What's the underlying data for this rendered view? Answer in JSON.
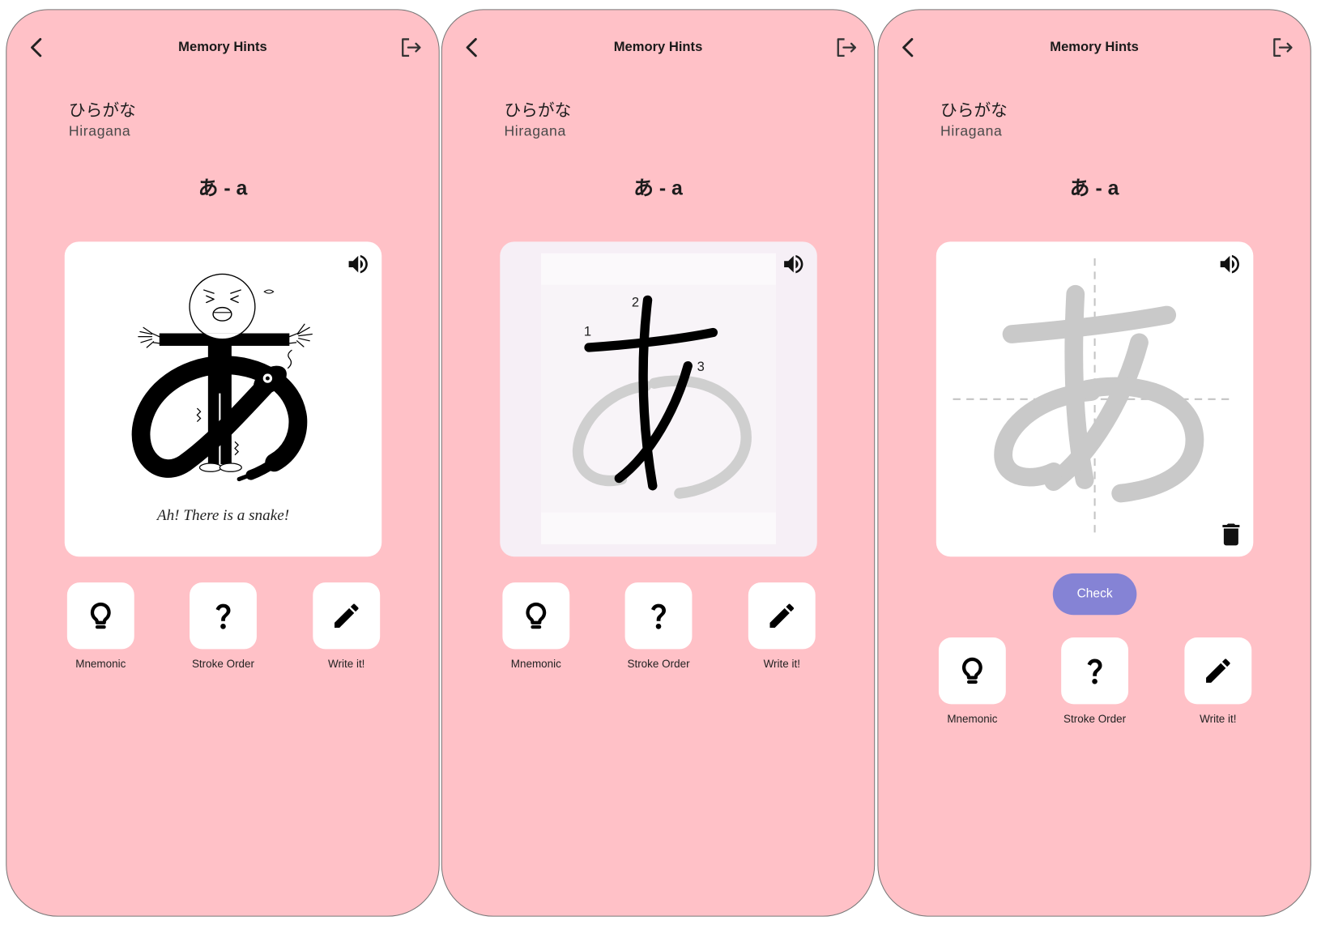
{
  "screens": [
    {
      "header": {
        "title": "Memory Hints",
        "back_icon": "chevron-left-icon",
        "exit_icon": "logout-icon"
      },
      "script": {
        "native": "ひらがな",
        "romaji": "Hiragana"
      },
      "character": "あ - a",
      "card": {
        "speaker_icon": "speaker-icon",
        "caption": "Ah! There is a snake!"
      },
      "actions": [
        {
          "label": "Mnemonic",
          "icon": "lightbulb-icon"
        },
        {
          "label": "Stroke Order",
          "icon": "question-mark-icon"
        },
        {
          "label": "Write it!",
          "icon": "pencil-icon"
        }
      ]
    },
    {
      "header": {
        "title": "Memory Hints",
        "back_icon": "chevron-left-icon",
        "exit_icon": "logout-icon"
      },
      "script": {
        "native": "ひらがな",
        "romaji": "Hiragana"
      },
      "character": "あ - a",
      "card": {
        "speaker_icon": "speaker-icon",
        "stroke_numbers": [
          "1",
          "2",
          "3"
        ]
      },
      "actions": [
        {
          "label": "Mnemonic",
          "icon": "lightbulb-icon"
        },
        {
          "label": "Stroke Order",
          "icon": "question-mark-icon"
        },
        {
          "label": "Write it!",
          "icon": "pencil-icon"
        }
      ]
    },
    {
      "header": {
        "title": "Memory Hints",
        "back_icon": "chevron-left-icon",
        "exit_icon": "logout-icon"
      },
      "script": {
        "native": "ひらがな",
        "romaji": "Hiragana"
      },
      "character": "あ - a",
      "card": {
        "speaker_icon": "speaker-icon",
        "clear_icon": "trash-icon"
      },
      "check_button": "Check",
      "actions": [
        {
          "label": "Mnemonic",
          "icon": "lightbulb-icon"
        },
        {
          "label": "Stroke Order",
          "icon": "question-mark-icon"
        },
        {
          "label": "Write it!",
          "icon": "pencil-icon"
        }
      ]
    }
  ],
  "colors": {
    "screen_background": "#ffc1c7",
    "card_background": "#ffffff",
    "stroke_order_background": "#f6eff6",
    "guide_character": "#c9c9c9",
    "check_button": "#8583d5"
  }
}
